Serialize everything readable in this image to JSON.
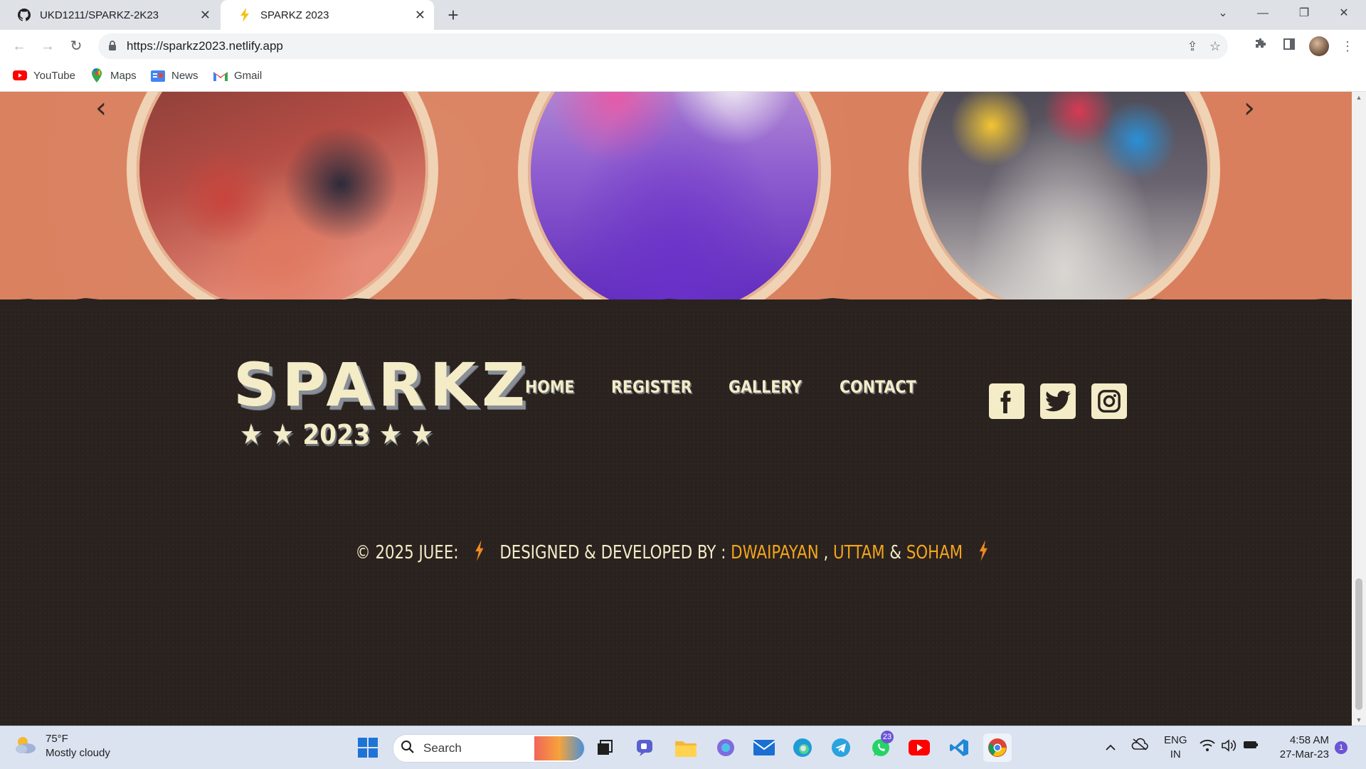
{
  "browser": {
    "tabs": [
      {
        "title": "UKD1211/SPARKZ-2K23",
        "icon": "github-icon",
        "active": false
      },
      {
        "title": "SPARKZ 2023",
        "icon": "bolt-icon",
        "active": true
      }
    ],
    "address_url": "https://sparkz2023.netlify.app",
    "bookmarks": [
      {
        "label": "YouTube",
        "icon": "youtube-icon"
      },
      {
        "label": "Maps",
        "icon": "maps-icon"
      },
      {
        "label": "News",
        "icon": "news-icon"
      },
      {
        "label": "Gmail",
        "icon": "gmail-icon"
      }
    ]
  },
  "page": {
    "carousel": {
      "prev_icon": "chevron-left-icon",
      "next_icon": "chevron-right-icon"
    },
    "footer": {
      "logo_title": "SPARKZ",
      "logo_year": "2023",
      "nav": [
        "HOME",
        "REGISTER",
        "GALLERY",
        "CONTACT"
      ],
      "social": [
        "facebook-icon",
        "twitter-icon",
        "instagram-icon"
      ],
      "credits": {
        "copyright": "© 2025 JUEE:",
        "designed_by": "DESIGNED & DEVELOPED BY :",
        "names": [
          "DWAIPAYAN",
          "UTTAM",
          "SOHAM"
        ],
        "sep_comma": ",",
        "sep_amp": "&"
      }
    }
  },
  "taskbar": {
    "weather_temp": "75°F",
    "weather_desc": "Mostly cloudy",
    "search_label": "Search",
    "whatsapp_badge": "23",
    "lang_line1": "ENG",
    "lang_line2": "IN",
    "time": "4:58 AM",
    "date": "27-Mar-23",
    "notification_count": "1"
  },
  "colors": {
    "accent_orange": "#f3a51c",
    "footer_bg": "#2a221f",
    "band_bg": "#d97f5d",
    "cream": "#f3ecc7"
  }
}
